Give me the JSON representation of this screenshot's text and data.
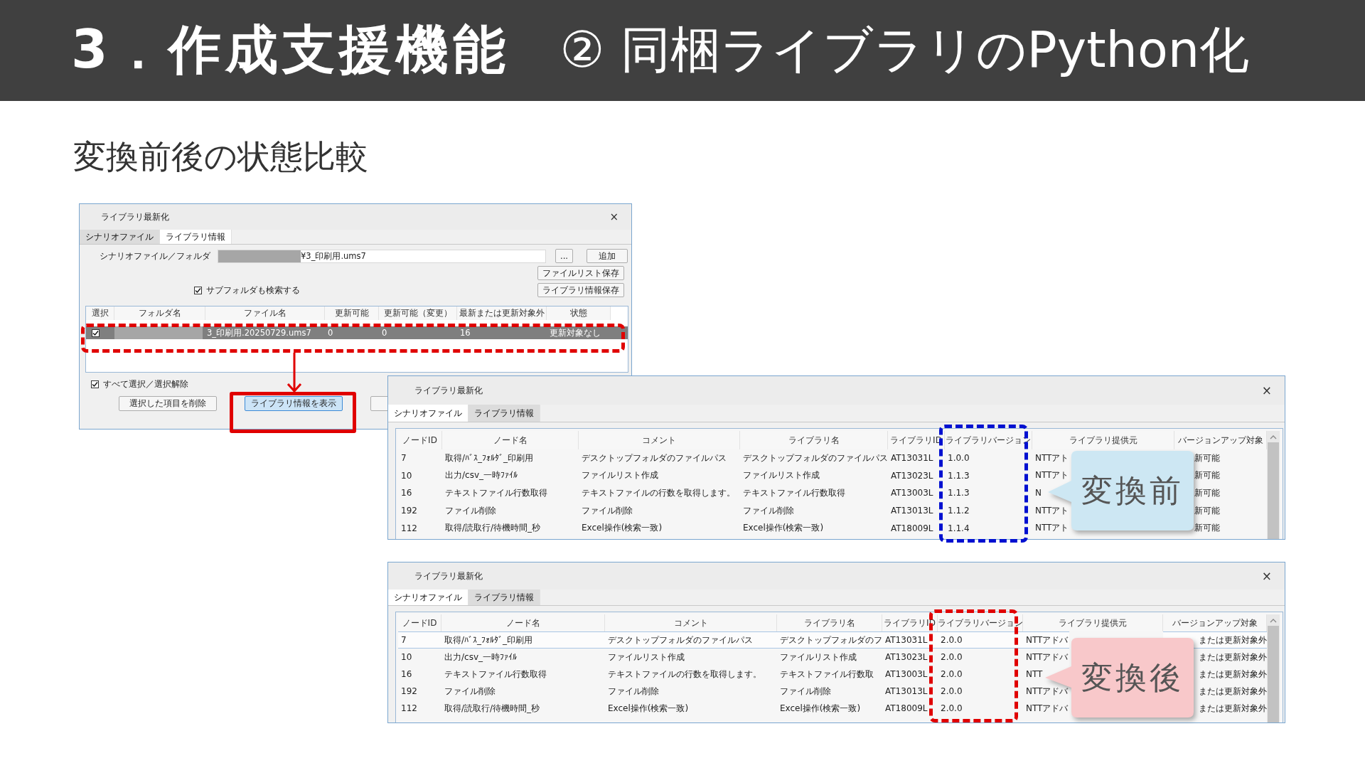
{
  "header": {
    "title": "3．作成支援機能",
    "subtitle": "② 同梱ライブラリのPython化"
  },
  "heading": "変換前後の状態比較",
  "main_dialog": {
    "title": "ライブラリ最新化",
    "close": "×",
    "tabs": [
      {
        "label": "シナリオファイル",
        "selected": false
      },
      {
        "label": "ライブラリ情報",
        "selected": true
      }
    ],
    "path_label": "シナリオファイル／フォルダ",
    "path_value": "¥3_印刷用.ums7",
    "browse_button": "...",
    "add_button": "追加",
    "save_list_button": "ファイルリスト保存",
    "save_info_button": "ライブラリ情報保存",
    "subfolder_option": {
      "label": "サブフォルダも検索する",
      "checked": true
    },
    "table": {
      "columns": [
        "選択",
        "フォルダ名",
        "ファイル名",
        "更新可能",
        "更新可能（変更）",
        "最新または更新対象外",
        "状態"
      ],
      "rows": [
        {
          "checked": true,
          "selected": true,
          "cells": [
            "",
            "",
            "3_印刷用.20250729.ums7",
            "0",
            "0",
            "16",
            "更新対象なし"
          ]
        }
      ]
    },
    "select_all": {
      "label": "すべて選択／選択解除",
      "checked": true
    },
    "buttons": [
      {
        "label": "選択した項目を削除",
        "selected": false
      },
      {
        "label": "ライブラリ情報を表示",
        "selected": true
      }
    ]
  },
  "library_dialogs": [
    {
      "title": "ライブラリ最新化",
      "close": "×",
      "tabs": [
        {
          "label": "シナリオファイル",
          "selected": true
        },
        {
          "label": "ライブラリ情報",
          "selected": false
        }
      ],
      "columns": [
        "ノードID",
        "ノード名",
        "コメント",
        "ライブラリ名",
        "ライブラリID",
        "ライブラリバージョン",
        "ライブラリ提供元",
        "バージョンアップ対象"
      ],
      "rows": [
        {
          "selected": false,
          "cells": [
            "7",
            "取得/ﾊﾞｽ_ﾌｫﾙﾀﾞ_印刷用",
            "デスクトップフォルダのファイルパス",
            "デスクトップフォルダのファイルパス",
            "AT13031L",
            "1.0.0",
            "NTTアト",
            "新可能"
          ]
        },
        {
          "selected": false,
          "cells": [
            "10",
            "出力/csv_一時ﾌｧｲﾙ",
            "ファイルリスト作成",
            "ファイルリスト作成",
            "AT13023L",
            "1.1.3",
            "NTTアト",
            "新可能"
          ]
        },
        {
          "selected": false,
          "cells": [
            "16",
            "テキストファイル行数取得",
            "テキストファイルの行数を取得します。",
            "テキストファイル行数取得",
            "AT13003L",
            "1.1.3",
            "N",
            "新可能"
          ]
        },
        {
          "selected": false,
          "cells": [
            "192",
            "ファイル削除",
            "ファイル削除",
            "ファイル削除",
            "AT13013L",
            "1.1.2",
            "NTTアト",
            "新可能"
          ]
        },
        {
          "selected": false,
          "cells": [
            "112",
            "取得/読取行/待機時間_秒",
            "Excel操作(検索一致)",
            "Excel操作(検索一致)",
            "AT18009L",
            "1.1.4",
            "NTTアト",
            "新可能"
          ]
        }
      ],
      "version_frame": {
        "color": "#0010d0"
      },
      "callout": {
        "text": "変換前",
        "color": "#cde7f3"
      }
    },
    {
      "title": "ライブラリ最新化",
      "close": "×",
      "tabs": [
        {
          "label": "シナリオファイル",
          "selected": true
        },
        {
          "label": "ライブラリ情報",
          "selected": false
        }
      ],
      "columns": [
        "ノードID",
        "ノード名",
        "コメント",
        "ライブラリ名",
        "ライブラリID",
        "ライブラリバージョン",
        "ライブラリ提供元",
        "バージョンアップ対象"
      ],
      "rows": [
        {
          "selected": true,
          "cells": [
            "7",
            "取得/ﾊﾞｽ_ﾌｫﾙﾀﾞ_印刷用",
            "デスクトップフォルダのファイルパス",
            "デスクトップフォルダのフ",
            "AT13031L",
            "2.0.0",
            "NTTアドバ",
            "または更新対象外"
          ]
        },
        {
          "selected": false,
          "cells": [
            "10",
            "出力/csv_一時ﾌｧｲﾙ",
            "ファイルリスト作成",
            "ファイルリスト作成",
            "AT13023L",
            "2.0.0",
            "NTTアドバ",
            "または更新対象外"
          ]
        },
        {
          "selected": false,
          "cells": [
            "16",
            "テキストファイル行数取得",
            "テキストファイルの行数を取得します。",
            "テキストファイル行数取",
            "AT13003L",
            "2.0.0",
            "NTT",
            "または更新対象外"
          ]
        },
        {
          "selected": false,
          "cells": [
            "192",
            "ファイル削除",
            "ファイル削除",
            "ファイル削除",
            "AT13013L",
            "2.0.0",
            "NTTアドバ",
            "または更新対象外"
          ]
        },
        {
          "selected": false,
          "cells": [
            "112",
            "取得/読取行/待機時間_秒",
            "Excel操作(検索一致)",
            "Excel操作(検索一致)",
            "AT18009L",
            "2.0.0",
            "NTTアドバ",
            "または更新対象外"
          ]
        }
      ],
      "version_frame": {
        "color": "#e00000"
      },
      "callout": {
        "text": "変換後",
        "color": "#f8c8ca"
      }
    }
  ]
}
